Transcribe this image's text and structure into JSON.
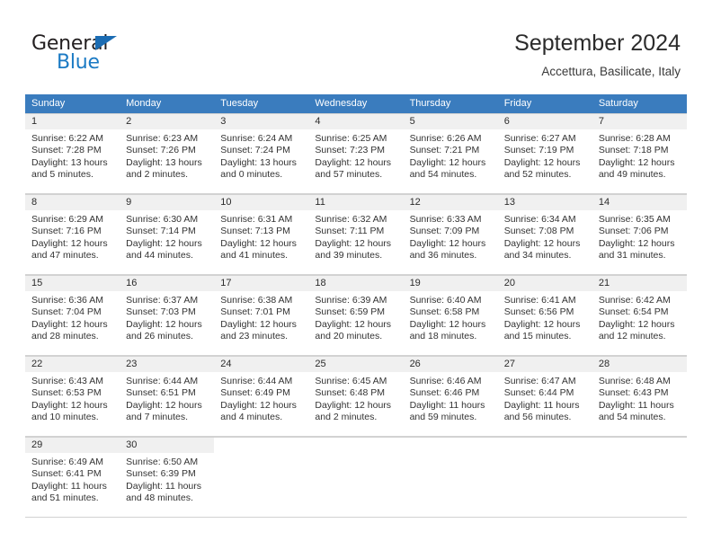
{
  "brand": {
    "name_top": "General",
    "name_bottom": "Blue",
    "triangle_color": "#1b6cb3",
    "blue_color": "#1b7ac4"
  },
  "header": {
    "title": "September 2024",
    "subtitle": "Accettura, Basilicate, Italy"
  },
  "theme": {
    "header_row_bg": "#3a7cbe",
    "daynum_bg": "#f0f0f0",
    "grid_line": "#d2d2d2",
    "text": "#333333"
  },
  "weekdays": [
    "Sunday",
    "Monday",
    "Tuesday",
    "Wednesday",
    "Thursday",
    "Friday",
    "Saturday"
  ],
  "labels": {
    "sunrise_prefix": "Sunrise:",
    "sunset_prefix": "Sunset:",
    "daylight_prefix": "Daylight:"
  },
  "weeks": [
    [
      {
        "day": "1",
        "sunrise": "Sunrise: 6:22 AM",
        "sunset": "Sunset: 7:28 PM",
        "daylight_1": "Daylight: 13 hours",
        "daylight_2": "and 5 minutes."
      },
      {
        "day": "2",
        "sunrise": "Sunrise: 6:23 AM",
        "sunset": "Sunset: 7:26 PM",
        "daylight_1": "Daylight: 13 hours",
        "daylight_2": "and 2 minutes."
      },
      {
        "day": "3",
        "sunrise": "Sunrise: 6:24 AM",
        "sunset": "Sunset: 7:24 PM",
        "daylight_1": "Daylight: 13 hours",
        "daylight_2": "and 0 minutes."
      },
      {
        "day": "4",
        "sunrise": "Sunrise: 6:25 AM",
        "sunset": "Sunset: 7:23 PM",
        "daylight_1": "Daylight: 12 hours",
        "daylight_2": "and 57 minutes."
      },
      {
        "day": "5",
        "sunrise": "Sunrise: 6:26 AM",
        "sunset": "Sunset: 7:21 PM",
        "daylight_1": "Daylight: 12 hours",
        "daylight_2": "and 54 minutes."
      },
      {
        "day": "6",
        "sunrise": "Sunrise: 6:27 AM",
        "sunset": "Sunset: 7:19 PM",
        "daylight_1": "Daylight: 12 hours",
        "daylight_2": "and 52 minutes."
      },
      {
        "day": "7",
        "sunrise": "Sunrise: 6:28 AM",
        "sunset": "Sunset: 7:18 PM",
        "daylight_1": "Daylight: 12 hours",
        "daylight_2": "and 49 minutes."
      }
    ],
    [
      {
        "day": "8",
        "sunrise": "Sunrise: 6:29 AM",
        "sunset": "Sunset: 7:16 PM",
        "daylight_1": "Daylight: 12 hours",
        "daylight_2": "and 47 minutes."
      },
      {
        "day": "9",
        "sunrise": "Sunrise: 6:30 AM",
        "sunset": "Sunset: 7:14 PM",
        "daylight_1": "Daylight: 12 hours",
        "daylight_2": "and 44 minutes."
      },
      {
        "day": "10",
        "sunrise": "Sunrise: 6:31 AM",
        "sunset": "Sunset: 7:13 PM",
        "daylight_1": "Daylight: 12 hours",
        "daylight_2": "and 41 minutes."
      },
      {
        "day": "11",
        "sunrise": "Sunrise: 6:32 AM",
        "sunset": "Sunset: 7:11 PM",
        "daylight_1": "Daylight: 12 hours",
        "daylight_2": "and 39 minutes."
      },
      {
        "day": "12",
        "sunrise": "Sunrise: 6:33 AM",
        "sunset": "Sunset: 7:09 PM",
        "daylight_1": "Daylight: 12 hours",
        "daylight_2": "and 36 minutes."
      },
      {
        "day": "13",
        "sunrise": "Sunrise: 6:34 AM",
        "sunset": "Sunset: 7:08 PM",
        "daylight_1": "Daylight: 12 hours",
        "daylight_2": "and 34 minutes."
      },
      {
        "day": "14",
        "sunrise": "Sunrise: 6:35 AM",
        "sunset": "Sunset: 7:06 PM",
        "daylight_1": "Daylight: 12 hours",
        "daylight_2": "and 31 minutes."
      }
    ],
    [
      {
        "day": "15",
        "sunrise": "Sunrise: 6:36 AM",
        "sunset": "Sunset: 7:04 PM",
        "daylight_1": "Daylight: 12 hours",
        "daylight_2": "and 28 minutes."
      },
      {
        "day": "16",
        "sunrise": "Sunrise: 6:37 AM",
        "sunset": "Sunset: 7:03 PM",
        "daylight_1": "Daylight: 12 hours",
        "daylight_2": "and 26 minutes."
      },
      {
        "day": "17",
        "sunrise": "Sunrise: 6:38 AM",
        "sunset": "Sunset: 7:01 PM",
        "daylight_1": "Daylight: 12 hours",
        "daylight_2": "and 23 minutes."
      },
      {
        "day": "18",
        "sunrise": "Sunrise: 6:39 AM",
        "sunset": "Sunset: 6:59 PM",
        "daylight_1": "Daylight: 12 hours",
        "daylight_2": "and 20 minutes."
      },
      {
        "day": "19",
        "sunrise": "Sunrise: 6:40 AM",
        "sunset": "Sunset: 6:58 PM",
        "daylight_1": "Daylight: 12 hours",
        "daylight_2": "and 18 minutes."
      },
      {
        "day": "20",
        "sunrise": "Sunrise: 6:41 AM",
        "sunset": "Sunset: 6:56 PM",
        "daylight_1": "Daylight: 12 hours",
        "daylight_2": "and 15 minutes."
      },
      {
        "day": "21",
        "sunrise": "Sunrise: 6:42 AM",
        "sunset": "Sunset: 6:54 PM",
        "daylight_1": "Daylight: 12 hours",
        "daylight_2": "and 12 minutes."
      }
    ],
    [
      {
        "day": "22",
        "sunrise": "Sunrise: 6:43 AM",
        "sunset": "Sunset: 6:53 PM",
        "daylight_1": "Daylight: 12 hours",
        "daylight_2": "and 10 minutes."
      },
      {
        "day": "23",
        "sunrise": "Sunrise: 6:44 AM",
        "sunset": "Sunset: 6:51 PM",
        "daylight_1": "Daylight: 12 hours",
        "daylight_2": "and 7 minutes."
      },
      {
        "day": "24",
        "sunrise": "Sunrise: 6:44 AM",
        "sunset": "Sunset: 6:49 PM",
        "daylight_1": "Daylight: 12 hours",
        "daylight_2": "and 4 minutes."
      },
      {
        "day": "25",
        "sunrise": "Sunrise: 6:45 AM",
        "sunset": "Sunset: 6:48 PM",
        "daylight_1": "Daylight: 12 hours",
        "daylight_2": "and 2 minutes."
      },
      {
        "day": "26",
        "sunrise": "Sunrise: 6:46 AM",
        "sunset": "Sunset: 6:46 PM",
        "daylight_1": "Daylight: 11 hours",
        "daylight_2": "and 59 minutes."
      },
      {
        "day": "27",
        "sunrise": "Sunrise: 6:47 AM",
        "sunset": "Sunset: 6:44 PM",
        "daylight_1": "Daylight: 11 hours",
        "daylight_2": "and 56 minutes."
      },
      {
        "day": "28",
        "sunrise": "Sunrise: 6:48 AM",
        "sunset": "Sunset: 6:43 PM",
        "daylight_1": "Daylight: 11 hours",
        "daylight_2": "and 54 minutes."
      }
    ],
    [
      {
        "day": "29",
        "sunrise": "Sunrise: 6:49 AM",
        "sunset": "Sunset: 6:41 PM",
        "daylight_1": "Daylight: 11 hours",
        "daylight_2": "and 51 minutes."
      },
      {
        "day": "30",
        "sunrise": "Sunrise: 6:50 AM",
        "sunset": "Sunset: 6:39 PM",
        "daylight_1": "Daylight: 11 hours",
        "daylight_2": "and 48 minutes."
      },
      {
        "day": "",
        "sunrise": "",
        "sunset": "",
        "daylight_1": "",
        "daylight_2": ""
      },
      {
        "day": "",
        "sunrise": "",
        "sunset": "",
        "daylight_1": "",
        "daylight_2": ""
      },
      {
        "day": "",
        "sunrise": "",
        "sunset": "",
        "daylight_1": "",
        "daylight_2": ""
      },
      {
        "day": "",
        "sunrise": "",
        "sunset": "",
        "daylight_1": "",
        "daylight_2": ""
      },
      {
        "day": "",
        "sunrise": "",
        "sunset": "",
        "daylight_1": "",
        "daylight_2": ""
      }
    ]
  ]
}
